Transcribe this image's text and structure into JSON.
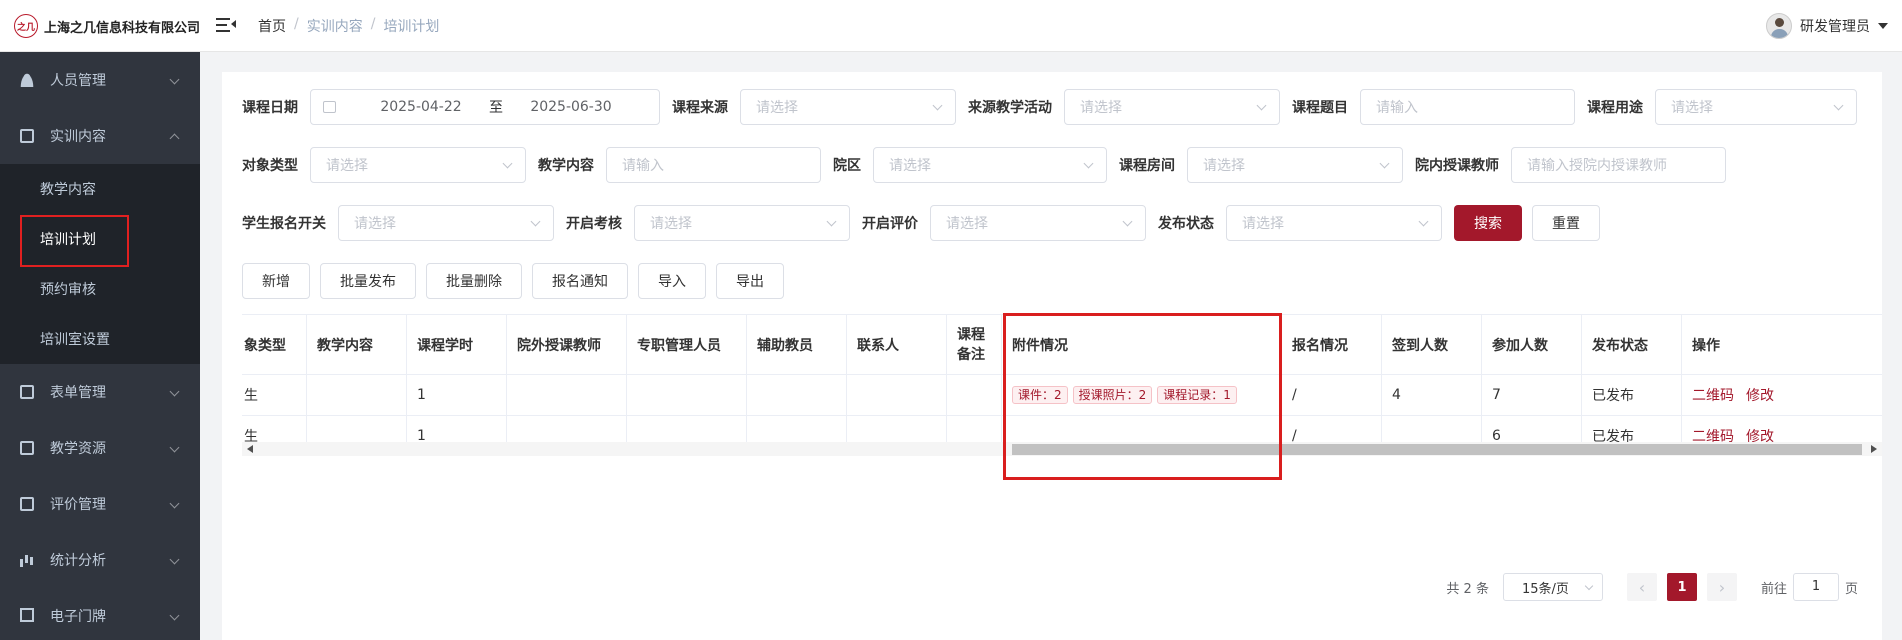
{
  "header": {
    "logo_mark": "之几",
    "company": "上海之几信息科技有限公司",
    "breadcrumb": [
      "首页",
      "实训内容",
      "培训计划"
    ],
    "user_name": "研发管理员"
  },
  "sidebar": {
    "items": [
      {
        "label": "人员管理"
      },
      {
        "label": "实训内容"
      },
      {
        "label": "表单管理"
      },
      {
        "label": "教学资源"
      },
      {
        "label": "评价管理"
      },
      {
        "label": "统计分析"
      },
      {
        "label": "电子门牌"
      }
    ],
    "sub_items": [
      "教学内容",
      "培训计划",
      "预约审核",
      "培训室设置"
    ]
  },
  "filters": {
    "course_date": {
      "label": "课程日期",
      "start": "2025-04-22",
      "sep": "至",
      "end": "2025-06-30"
    },
    "course_source": {
      "label": "课程来源",
      "placeholder": "请选择"
    },
    "source_activity": {
      "label": "来源教学活动",
      "placeholder": "请选择"
    },
    "course_topic": {
      "label": "课程题目",
      "placeholder": "请输入"
    },
    "course_use": {
      "label": "课程用途",
      "placeholder": "请选择"
    },
    "object_type": {
      "label": "对象类型",
      "placeholder": "请选择"
    },
    "teaching_content": {
      "label": "教学内容",
      "placeholder": "请输入"
    },
    "campus": {
      "label": "院区",
      "placeholder": "请选择"
    },
    "course_room": {
      "label": "课程房间",
      "placeholder": "请选择"
    },
    "internal_teacher": {
      "label": "院内授课教师",
      "placeholder": "请输入授院内授课教师"
    },
    "signup_switch": {
      "label": "学生报名开关",
      "placeholder": "请选择"
    },
    "exam_switch": {
      "label": "开启考核",
      "placeholder": "请选择"
    },
    "eval_switch": {
      "label": "开启评价",
      "placeholder": "请选择"
    },
    "publish_status": {
      "label": "发布状态",
      "placeholder": "请选择"
    },
    "search_label": "搜索",
    "reset_label": "重置"
  },
  "actions": [
    "新增",
    "批量发布",
    "批量删除",
    "报名通知",
    "导入",
    "导出"
  ],
  "table": {
    "columns": [
      "象类型",
      "教学内容",
      "课程学时",
      "院外授课教师",
      "专职管理人员",
      "辅助教员",
      "联系人",
      "课程备注",
      "附件情况",
      "报名情况",
      "签到人数",
      "参加人数",
      "发布状态",
      "操作"
    ],
    "remark_line1": "课程",
    "remark_line2": "备注",
    "rows": [
      {
        "type": "生",
        "content": "",
        "hours": "1",
        "ext_teacher": "",
        "manager": "",
        "assistant": "",
        "contact": "",
        "remark": "",
        "tags": [
          "课件：2",
          "授课照片：2",
          "课程记录：1"
        ],
        "signup": "/",
        "signin": "4",
        "join": "7",
        "status": "已发布",
        "ops": [
          "二维码",
          "修改"
        ]
      },
      {
        "type": "生",
        "content": "",
        "hours": "1",
        "ext_teacher": "",
        "manager": "",
        "assistant": "",
        "contact": "",
        "remark": "",
        "tags": [],
        "signup": "/",
        "signin": "",
        "join": "6",
        "status": "已发布",
        "ops": [
          "二维码",
          "修改"
        ]
      }
    ]
  },
  "pagination": {
    "total": "共 2 条",
    "page_size": "15条/页",
    "current": "1",
    "goto_label": "前往",
    "goto_value": "1",
    "page_suffix": "页",
    "prev": "‹",
    "next": "›"
  },
  "colors": {
    "accent": "#a3182b",
    "sidebar_bg": "#30353e",
    "highlight": "#d91e1e"
  }
}
